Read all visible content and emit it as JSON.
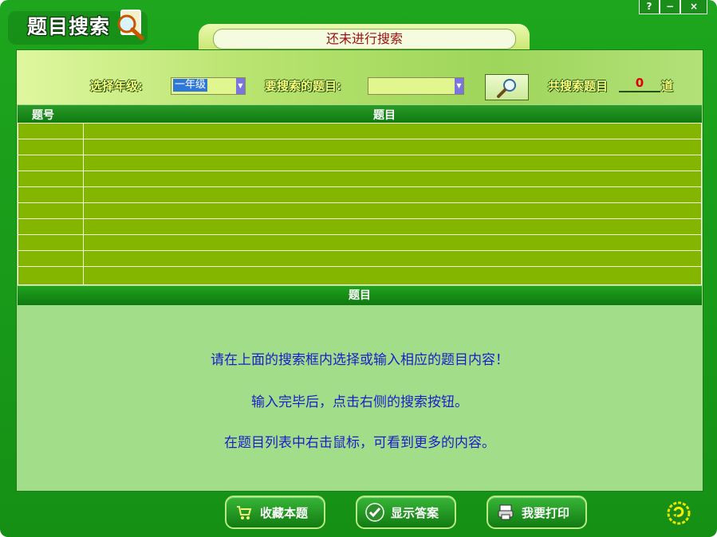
{
  "window": {
    "title": "题目搜索",
    "controls": [
      "?",
      "−",
      "×"
    ]
  },
  "status": {
    "text": "还未进行搜索"
  },
  "filters": {
    "grade_label": "选择年级:",
    "grade_value": "一年级",
    "subject_label": "要搜索的题目:",
    "subject_value": "",
    "count_label_before": "共搜索题目",
    "count_value": "0",
    "count_label_after": "道"
  },
  "results": {
    "columns": [
      "题号",
      "题目"
    ],
    "rows": 10
  },
  "detail": {
    "header": "题目",
    "messages": [
      "请在上面的搜索框内选择或输入相应的题目内容！",
      "输入完毕后，点击右侧的搜索按钮。",
      "在题目列表中右击鼠标，可看到更多的内容。"
    ]
  },
  "buttons": {
    "collect": "收藏本题",
    "show_answer": "显示答案",
    "print": "我要打印"
  },
  "colors": {
    "frame": "#1ea61e",
    "panel": "#a3dc89",
    "grid": "#84b600",
    "instruction_text": "#1b1ec8",
    "count_text": "#e00000",
    "status_text": "#9a1111"
  },
  "icons": {
    "logo": "magnifier-paper-icon",
    "search": "magnifier-icon",
    "collect": "cart-icon",
    "show_answer": "check-icon",
    "print": "printer-icon",
    "help": "refresh-help-icon"
  }
}
